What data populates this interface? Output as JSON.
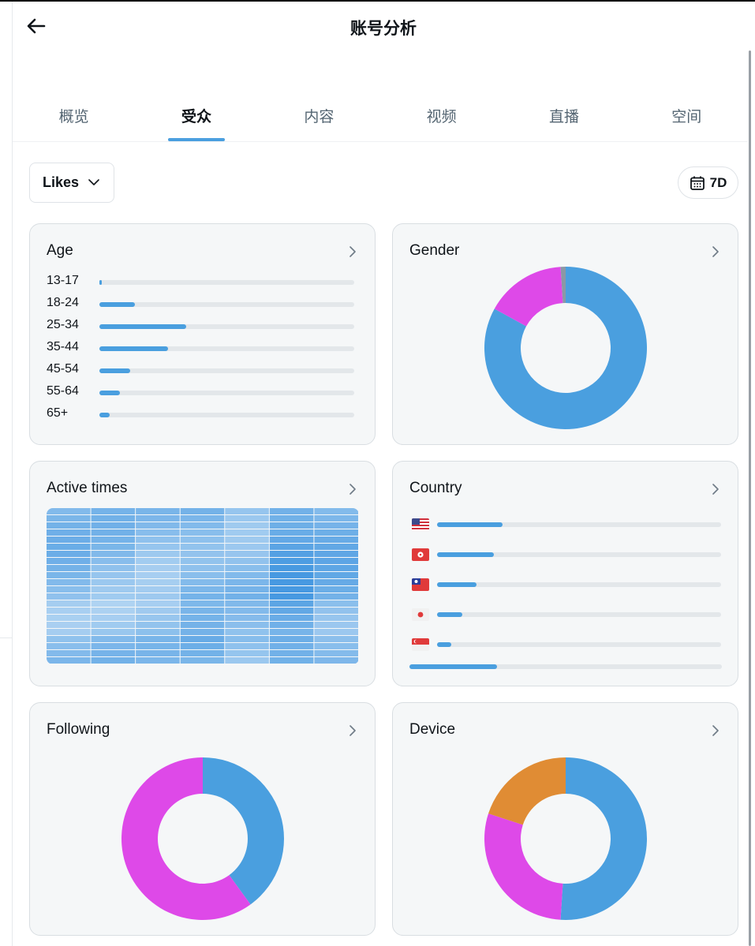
{
  "header": {
    "title": "账号分析",
    "back_icon": "arrow-left-icon"
  },
  "tabs": [
    {
      "label": "概览",
      "active": false
    },
    {
      "label": "受众",
      "active": true
    },
    {
      "label": "内容",
      "active": false
    },
    {
      "label": "视频",
      "active": false
    },
    {
      "label": "直播",
      "active": false
    },
    {
      "label": "空间",
      "active": false
    }
  ],
  "filters": {
    "metric": "Likes",
    "range": "7D"
  },
  "colors": {
    "accent": "#4a9fdf",
    "magenta": "#de49e8",
    "orange": "#e08c34",
    "gray": "#8b98a5",
    "track": "#e3e7ea"
  },
  "cards": {
    "age": {
      "title": "Age",
      "rows": [
        {
          "label": "13-17",
          "value": 0.01
        },
        {
          "label": "18-24",
          "value": 0.14
        },
        {
          "label": "25-34",
          "value": 0.34
        },
        {
          "label": "35-44",
          "value": 0.27
        },
        {
          "label": "45-54",
          "value": 0.12
        },
        {
          "label": "55-64",
          "value": 0.08
        },
        {
          "label": "65+",
          "value": 0.04
        }
      ]
    },
    "gender": {
      "title": "Gender",
      "segments": [
        {
          "value": 83,
          "color": "#4a9fdf"
        },
        {
          "value": 16,
          "color": "#de49e8"
        },
        {
          "value": 1,
          "color": "#8b98a5"
        }
      ]
    },
    "active_times": {
      "title": "Active times",
      "columns": 7,
      "rows": 22,
      "column_levels": [
        0.55,
        0.5,
        0.45,
        0.6,
        0.5,
        0.85,
        0.65
      ]
    },
    "country": {
      "title": "Country",
      "rows": [
        {
          "flag": "flag-us-icon",
          "value": 0.23
        },
        {
          "flag": "flag-hk-icon",
          "value": 0.2
        },
        {
          "flag": "flag-tw-icon",
          "value": 0.14
        },
        {
          "flag": "flag-jp-icon",
          "value": 0.09
        },
        {
          "flag": "flag-sg-icon",
          "value": 0.05
        }
      ],
      "other": 0.28
    },
    "following": {
      "title": "Following",
      "segments": [
        {
          "value": 40,
          "color": "#4a9fdf"
        },
        {
          "value": 60,
          "color": "#de49e8"
        }
      ]
    },
    "device": {
      "title": "Device",
      "segments": [
        {
          "value": 51,
          "color": "#4a9fdf"
        },
        {
          "value": 29,
          "color": "#de49e8"
        },
        {
          "value": 20,
          "color": "#e08c34"
        }
      ]
    }
  }
}
